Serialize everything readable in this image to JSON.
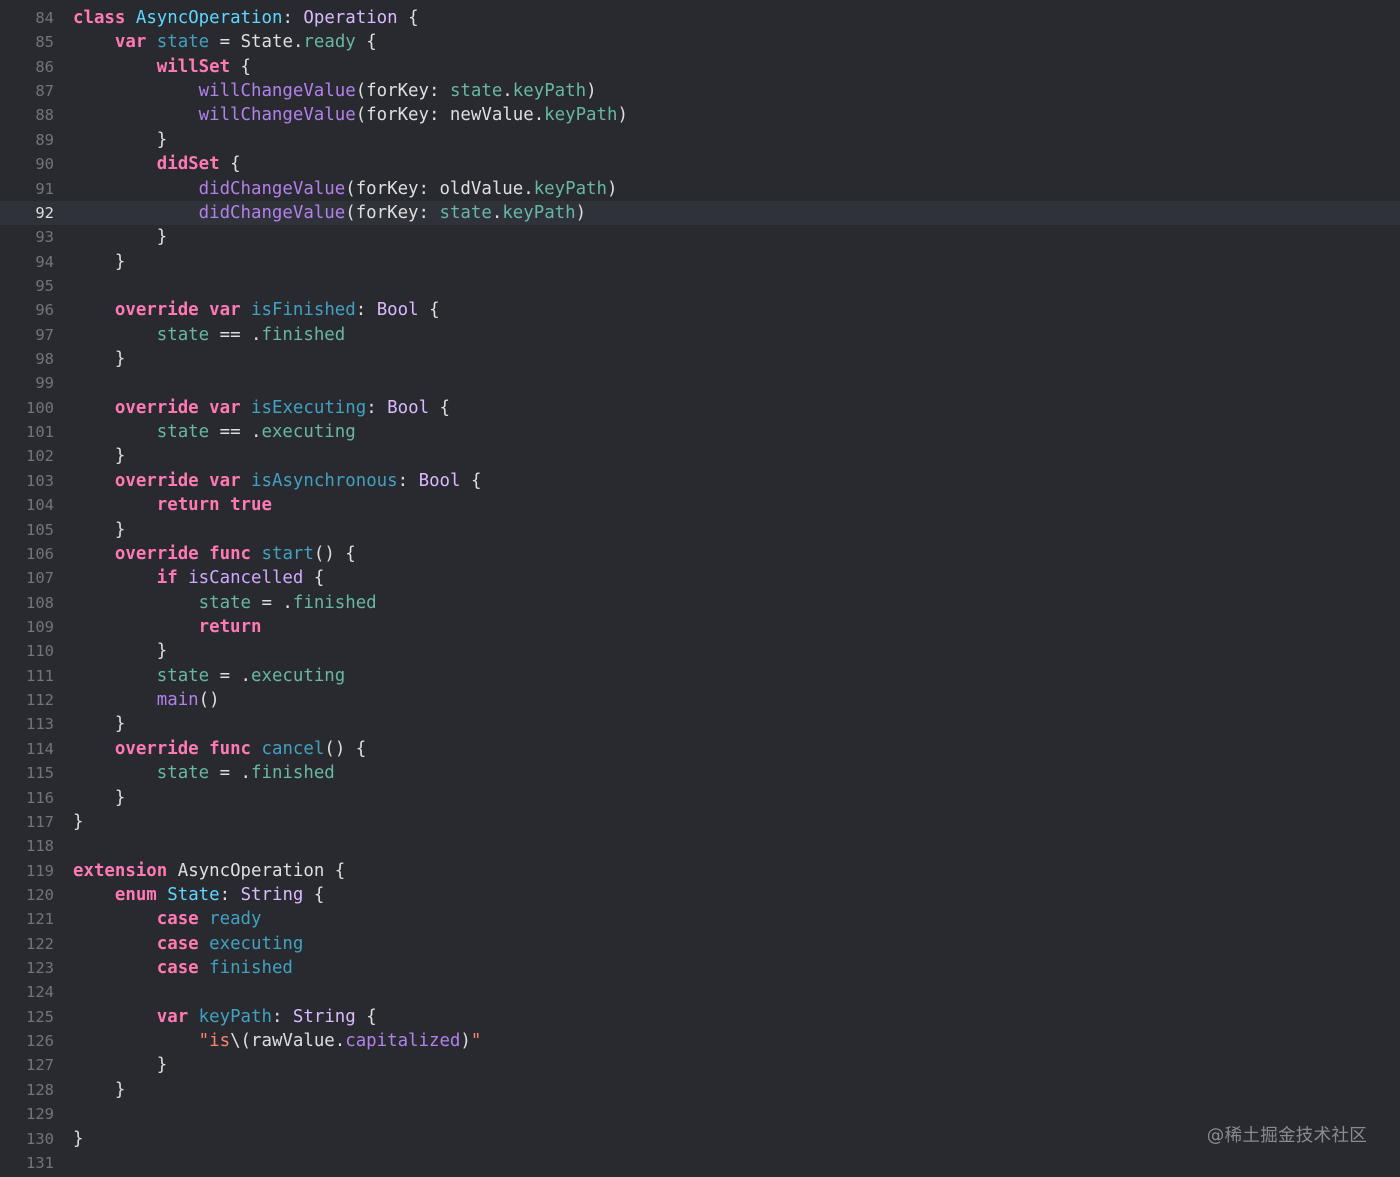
{
  "editor": {
    "current_line": 92,
    "lines": [
      {
        "n": "84",
        "t": [
          [
            "kw",
            "class"
          ],
          [
            "p",
            " "
          ],
          [
            "tdecl",
            "AsyncOperation"
          ],
          [
            "p",
            ": "
          ],
          [
            "tsys",
            "Operation"
          ],
          [
            "p",
            " {"
          ]
        ]
      },
      {
        "n": "85",
        "t": [
          [
            "p",
            "    "
          ],
          [
            "kw",
            "var"
          ],
          [
            "p",
            " "
          ],
          [
            "vdecl",
            "state"
          ],
          [
            "p",
            " = "
          ],
          [
            "ident",
            "State"
          ],
          [
            "p",
            "."
          ],
          [
            "prop",
            "ready"
          ],
          [
            "p",
            " {"
          ]
        ]
      },
      {
        "n": "86",
        "t": [
          [
            "p",
            "        "
          ],
          [
            "kw",
            "willSet"
          ],
          [
            "p",
            " {"
          ]
        ]
      },
      {
        "n": "87",
        "t": [
          [
            "p",
            "            "
          ],
          [
            "mth",
            "willChangeValue"
          ],
          [
            "p",
            "(forKey: "
          ],
          [
            "prop",
            "state"
          ],
          [
            "p",
            "."
          ],
          [
            "prop",
            "keyPath"
          ],
          [
            "p",
            ")"
          ]
        ]
      },
      {
        "n": "88",
        "t": [
          [
            "p",
            "            "
          ],
          [
            "mth",
            "willChangeValue"
          ],
          [
            "p",
            "(forKey: newValue."
          ],
          [
            "prop",
            "keyPath"
          ],
          [
            "p",
            ")"
          ]
        ]
      },
      {
        "n": "89",
        "t": [
          [
            "p",
            "        }"
          ]
        ]
      },
      {
        "n": "90",
        "t": [
          [
            "p",
            "        "
          ],
          [
            "kw",
            "didSet"
          ],
          [
            "p",
            " {"
          ]
        ]
      },
      {
        "n": "91",
        "t": [
          [
            "p",
            "            "
          ],
          [
            "mth",
            "didChangeValue"
          ],
          [
            "p",
            "(forKey: oldValue."
          ],
          [
            "prop",
            "keyPath"
          ],
          [
            "p",
            ")"
          ]
        ]
      },
      {
        "n": "92",
        "t": [
          [
            "p",
            "            "
          ],
          [
            "mth",
            "didChangeValue"
          ],
          [
            "p",
            "(forKey: "
          ],
          [
            "prop",
            "state"
          ],
          [
            "p",
            "."
          ],
          [
            "prop",
            "keyPath"
          ],
          [
            "p",
            ")"
          ]
        ]
      },
      {
        "n": "93",
        "t": [
          [
            "p",
            "        }"
          ]
        ]
      },
      {
        "n": "94",
        "t": [
          [
            "p",
            "    }"
          ]
        ]
      },
      {
        "n": "95",
        "t": []
      },
      {
        "n": "96",
        "t": [
          [
            "p",
            "    "
          ],
          [
            "kw",
            "override"
          ],
          [
            "p",
            " "
          ],
          [
            "kw",
            "var"
          ],
          [
            "p",
            " "
          ],
          [
            "vdecl",
            "isFinished"
          ],
          [
            "p",
            ": "
          ],
          [
            "tsys",
            "Bool"
          ],
          [
            "p",
            " {"
          ]
        ]
      },
      {
        "n": "97",
        "t": [
          [
            "p",
            "        "
          ],
          [
            "prop",
            "state"
          ],
          [
            "p",
            " == ."
          ],
          [
            "prop",
            "finished"
          ]
        ]
      },
      {
        "n": "98",
        "t": [
          [
            "p",
            "    }"
          ]
        ]
      },
      {
        "n": "99",
        "t": []
      },
      {
        "n": "100",
        "t": [
          [
            "p",
            "    "
          ],
          [
            "kw",
            "override"
          ],
          [
            "p",
            " "
          ],
          [
            "kw",
            "var"
          ],
          [
            "p",
            " "
          ],
          [
            "vdecl",
            "isExecuting"
          ],
          [
            "p",
            ": "
          ],
          [
            "tsys",
            "Bool"
          ],
          [
            "p",
            " {"
          ]
        ]
      },
      {
        "n": "101",
        "t": [
          [
            "p",
            "        "
          ],
          [
            "prop",
            "state"
          ],
          [
            "p",
            " == ."
          ],
          [
            "prop",
            "executing"
          ]
        ]
      },
      {
        "n": "102",
        "t": [
          [
            "p",
            "    }"
          ]
        ]
      },
      {
        "n": "103",
        "t": [
          [
            "p",
            "    "
          ],
          [
            "kw",
            "override"
          ],
          [
            "p",
            " "
          ],
          [
            "kw",
            "var"
          ],
          [
            "p",
            " "
          ],
          [
            "vdecl",
            "isAsynchronous"
          ],
          [
            "p",
            ": "
          ],
          [
            "tsys",
            "Bool"
          ],
          [
            "p",
            " {"
          ]
        ]
      },
      {
        "n": "104",
        "t": [
          [
            "p",
            "        "
          ],
          [
            "kw",
            "return"
          ],
          [
            "p",
            " "
          ],
          [
            "kw",
            "true"
          ]
        ]
      },
      {
        "n": "105",
        "t": [
          [
            "p",
            "    }"
          ]
        ]
      },
      {
        "n": "106",
        "t": [
          [
            "p",
            "    "
          ],
          [
            "kw",
            "override"
          ],
          [
            "p",
            " "
          ],
          [
            "kw",
            "func"
          ],
          [
            "p",
            " "
          ],
          [
            "vdecl",
            "start"
          ],
          [
            "p",
            "() {"
          ]
        ]
      },
      {
        "n": "107",
        "t": [
          [
            "p",
            "        "
          ],
          [
            "kw",
            "if"
          ],
          [
            "p",
            " "
          ],
          [
            "tref",
            "isCancelled"
          ],
          [
            "p",
            " {"
          ]
        ]
      },
      {
        "n": "108",
        "t": [
          [
            "p",
            "            "
          ],
          [
            "prop",
            "state"
          ],
          [
            "p",
            " = ."
          ],
          [
            "prop",
            "finished"
          ]
        ]
      },
      {
        "n": "109",
        "t": [
          [
            "p",
            "            "
          ],
          [
            "kw",
            "return"
          ]
        ]
      },
      {
        "n": "110",
        "t": [
          [
            "p",
            "        }"
          ]
        ]
      },
      {
        "n": "111",
        "t": [
          [
            "p",
            "        "
          ],
          [
            "prop",
            "state"
          ],
          [
            "p",
            " = ."
          ],
          [
            "prop",
            "executing"
          ]
        ]
      },
      {
        "n": "112",
        "t": [
          [
            "p",
            "        "
          ],
          [
            "mth",
            "main"
          ],
          [
            "p",
            "()"
          ]
        ]
      },
      {
        "n": "113",
        "t": [
          [
            "p",
            "    }"
          ]
        ]
      },
      {
        "n": "114",
        "t": [
          [
            "p",
            "    "
          ],
          [
            "kw",
            "override"
          ],
          [
            "p",
            " "
          ],
          [
            "kw",
            "func"
          ],
          [
            "p",
            " "
          ],
          [
            "vdecl",
            "cancel"
          ],
          [
            "p",
            "() {"
          ]
        ]
      },
      {
        "n": "115",
        "t": [
          [
            "p",
            "        "
          ],
          [
            "prop",
            "state"
          ],
          [
            "p",
            " = ."
          ],
          [
            "prop",
            "finished"
          ]
        ]
      },
      {
        "n": "116",
        "t": [
          [
            "p",
            "    }"
          ]
        ]
      },
      {
        "n": "117",
        "t": [
          [
            "p",
            "}"
          ]
        ]
      },
      {
        "n": "118",
        "t": []
      },
      {
        "n": "119",
        "t": [
          [
            "kw",
            "extension"
          ],
          [
            "p",
            " "
          ],
          [
            "ident",
            "AsyncOperation"
          ],
          [
            "p",
            " {"
          ]
        ]
      },
      {
        "n": "120",
        "t": [
          [
            "p",
            "    "
          ],
          [
            "kw",
            "enum"
          ],
          [
            "p",
            " "
          ],
          [
            "tdecl",
            "State"
          ],
          [
            "p",
            ": "
          ],
          [
            "tsys",
            "String"
          ],
          [
            "p",
            " {"
          ]
        ]
      },
      {
        "n": "121",
        "t": [
          [
            "p",
            "        "
          ],
          [
            "kw",
            "case"
          ],
          [
            "p",
            " "
          ],
          [
            "vdecl",
            "ready"
          ]
        ]
      },
      {
        "n": "122",
        "t": [
          [
            "p",
            "        "
          ],
          [
            "kw",
            "case"
          ],
          [
            "p",
            " "
          ],
          [
            "vdecl",
            "executing"
          ]
        ]
      },
      {
        "n": "123",
        "t": [
          [
            "p",
            "        "
          ],
          [
            "kw",
            "case"
          ],
          [
            "p",
            " "
          ],
          [
            "vdecl",
            "finished"
          ]
        ]
      },
      {
        "n": "124",
        "t": []
      },
      {
        "n": "125",
        "t": [
          [
            "p",
            "        "
          ],
          [
            "kw",
            "var"
          ],
          [
            "p",
            " "
          ],
          [
            "vdecl",
            "keyPath"
          ],
          [
            "p",
            ": "
          ],
          [
            "tsys",
            "String"
          ],
          [
            "p",
            " {"
          ]
        ]
      },
      {
        "n": "126",
        "t": [
          [
            "p",
            "            "
          ],
          [
            "str",
            "\"is"
          ],
          [
            "p",
            "\\(rawValue."
          ],
          [
            "mth",
            "capitalized"
          ],
          [
            "p",
            ")"
          ],
          [
            "str",
            "\""
          ]
        ]
      },
      {
        "n": "127",
        "t": [
          [
            "p",
            "        }"
          ]
        ]
      },
      {
        "n": "128",
        "t": [
          [
            "p",
            "    }"
          ]
        ]
      },
      {
        "n": "129",
        "t": []
      },
      {
        "n": "130",
        "t": [
          [
            "p",
            "}"
          ]
        ]
      },
      {
        "n": "131",
        "t": []
      }
    ]
  },
  "watermark": "@稀土掘金技术社区"
}
